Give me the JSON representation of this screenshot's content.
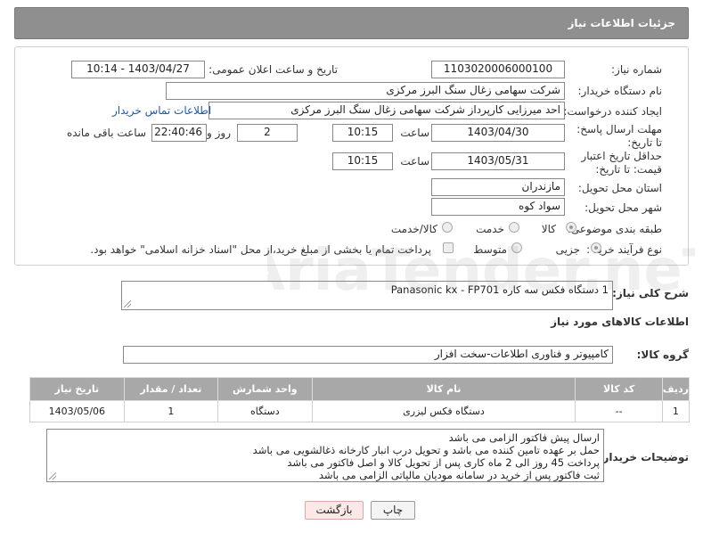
{
  "header": {
    "title": "جزئیات اطلاعات نیاز"
  },
  "form": {
    "need_number_label": "شماره نیاز:",
    "need_number": "1103020006000100",
    "announce_label": "تاریخ و ساعت اعلان عمومی:",
    "announce_value": "1403/04/27 - 10:14",
    "buyer_label": "نام دستگاه خریدار:",
    "buyer_value": "شرکت سهامی زغال سنگ البرز مرکزی",
    "creator_label": "ایجاد کننده درخواست:",
    "creator_value": "احد میرزایی کارپرداز شرکت سهامی زغال سنگ البرز مرکزی",
    "contact_link": "اطلاعات تماس خریدار",
    "deadline_label": "مهلت ارسال پاسخ: تا تاریخ:",
    "deadline_date": "1403/04/30",
    "time_label": "ساعت",
    "deadline_time": "10:15",
    "days_value": "2",
    "days_label": "روز و",
    "remaining_time": "22:40:46",
    "remaining_label": "ساعت باقی مانده",
    "validity_label": "حداقل تاریخ اعتبار قیمت: تا تاریخ:",
    "validity_date": "1403/05/31",
    "validity_time": "10:15",
    "province_label": "استان محل تحویل:",
    "province_value": "مازندران",
    "city_label": "شهر محل تحویل:",
    "city_value": "سواد کوه",
    "category_label": "طبقه بندی موضوعی:",
    "category_options": [
      "کالا",
      "خدمت",
      "کالا/خدمت"
    ],
    "process_label": "نوع فرآیند خرید :",
    "process_options": [
      "جزیی",
      "متوسط"
    ],
    "payment_note": "پرداخت تمام یا بخشی از مبلغ خرید،از محل \"اسناد خزانه اسلامی\" خواهد بود."
  },
  "summary": {
    "label": "شرح کلی نیاز:",
    "value": "1 دستگاه فکس سه کاره Panasonic kx - FP701"
  },
  "goods_title": "اطلاعات کالاهای مورد نیاز",
  "group": {
    "label": "گروه کالا:",
    "value": "کامپیوتر و فناوری اطلاعات-سخت افزار"
  },
  "table": {
    "headers": [
      "ردیف",
      "کد کالا",
      "نام کالا",
      "واحد شمارش",
      "تعداد / مقدار",
      "تاریخ نیاز"
    ],
    "rows": [
      [
        "1",
        "--",
        "دستگاه فکس لیزری",
        "دستگاه",
        "1",
        "1403/05/06"
      ]
    ]
  },
  "notes": {
    "label": "توضیحات خریدار:",
    "lines": [
      "ارسال پیش فاکتور الزامی می باشد",
      "حمل بر عهده تامین کننده می باشد و تحویل درب انبار کارخانه ذغالشویی می باشد",
      "پرداخت 45 روز الی 2 ماه کاری پس از تحویل کالا و اصل فاکتور می باشد",
      "ثبت فاکتور پس از خرید در سامانه مودیان مالیاتی الزامی می باشد"
    ]
  },
  "buttons": {
    "print": "چاپ",
    "back": "بازگشت"
  },
  "watermark_text": "AriaTender.neT",
  "colors": {
    "header_bg": "#8f8f8f",
    "link": "#1f5aa6",
    "back_btn": "#fde8e8"
  }
}
